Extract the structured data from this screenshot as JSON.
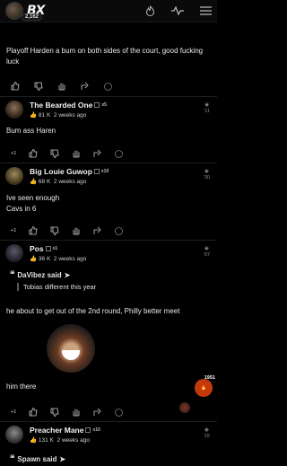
{
  "header": {
    "logo": "BX",
    "badge_count": "2,162"
  },
  "post0": {
    "text": "Playoff Harden a bum on both sides of the court, good fucking luck"
  },
  "post1": {
    "username": "The Bearded One",
    "rank": "x5",
    "likes": "81 K",
    "time": "2 weeks ago",
    "views": "'11",
    "text": "Bum ass Haren",
    "plus": "+1"
  },
  "post2": {
    "username": "Big Louie Guwop",
    "rank": "x10",
    "likes": "68 K",
    "time": "2 weeks ago",
    "views": "'30",
    "text1": "Ive seen enough",
    "text2": "Cavs in 6",
    "plus": "+1"
  },
  "post3": {
    "username": "Pos",
    "rank": "x1",
    "likes": "36 K",
    "time": "2 weeks ago",
    "views": "'07",
    "quote_author": "DaVibez said",
    "quote_text": "Tobias different this year",
    "text": "he about to get out of the 2nd round, Philly better meet",
    "text2": "him there",
    "plus": "+1"
  },
  "post4": {
    "username": "Preacher Mane",
    "rank": "x10",
    "likes": "131 K",
    "time": "2 weeks ago",
    "views": "'15",
    "quote_author": "Spawn said"
  },
  "fab": {
    "count": "1951"
  },
  "colors": {
    "accent": "#c4390b",
    "background": "#000000"
  }
}
